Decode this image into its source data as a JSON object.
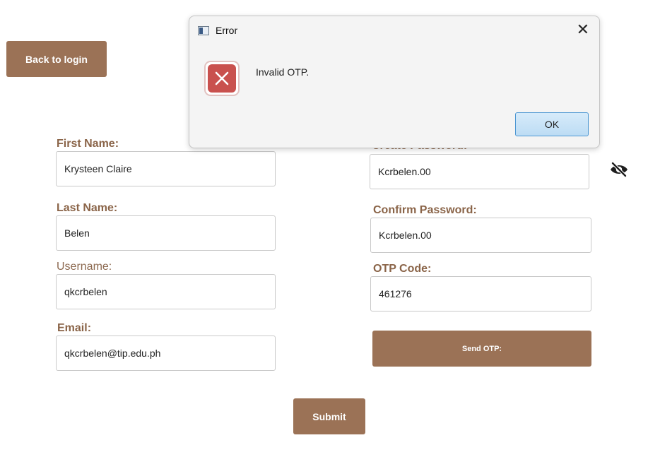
{
  "back_button": {
    "label": "Back to login"
  },
  "dialog": {
    "title": "Error",
    "message": "Invalid OTP.",
    "ok_label": "OK",
    "icon": "error-icon"
  },
  "form": {
    "first_name": {
      "label": "First Name:",
      "value": "Krysteen Claire"
    },
    "last_name": {
      "label": "Last Name:",
      "value": "Belen"
    },
    "username": {
      "label": "Username:",
      "value": "qkcrbelen"
    },
    "email": {
      "label": "Email:",
      "value": "qkcrbelen@tip.edu.ph"
    },
    "create_password": {
      "label": "Create Password:",
      "value": "Kcrbelen.00"
    },
    "confirm_password": {
      "label": "Confirm Password:",
      "value": "Kcrbelen.00"
    },
    "otp_code": {
      "label": "OTP Code:",
      "value": "461276"
    },
    "send_otp_label": "Send OTP:",
    "submit_label": "Submit"
  },
  "icons": {
    "password_toggle": "eye-slash-icon"
  },
  "colors": {
    "accent": "#9b7256",
    "label": "#8a6448",
    "error": "#c9514e",
    "ok_border": "#4d97d2"
  }
}
